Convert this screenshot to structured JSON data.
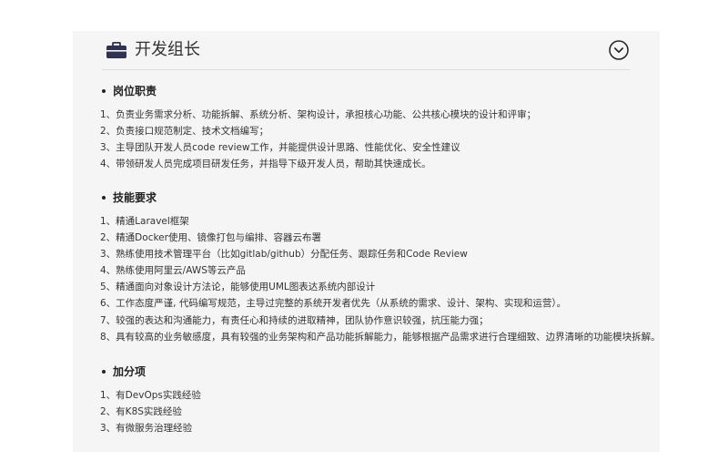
{
  "header": {
    "title": "开发组长",
    "icon": "briefcase-icon",
    "toggle_icon": "chevron-down-circle-icon"
  },
  "sections": [
    {
      "title": "岗位职责",
      "items": [
        "1、负责业务需求分析、功能拆解、系统分析、架构设计，承担核心功能、公共核心模块的设计和评审；",
        "2、负责接口规范制定、技术文档编写；",
        "3、主导团队开发人员code review工作，并能提供设计思路、性能优化、安全性建议",
        "4、带领研发人员完成项目研发任务，并指导下级开发人员，帮助其快速成长。"
      ]
    },
    {
      "title": "技能要求",
      "items": [
        "1、精通Laravel框架",
        "2、精通Docker使用、镜像打包与编排、容器云布署",
        "3、熟练使用技术管理平台（比如gitlab/github）分配任务、跟踪任务和Code Review",
        "4、熟练使用阿里云/AWS等云产品",
        "5、精通面向对象设计方法论，能够使用UML图表达系统内部设计",
        "6、工作态度严谨, 代码编写规范，主导过完整的系统开发者优先（从系统的需求、设计、架构、实现和运营）。",
        "7、较强的表达和沟通能力，有责任心和持续的进取精神，团队协作意识较强，抗压能力强；",
        "8、具有较高的业务敏感度，具有较强的业务架构和产品功能拆解能力，能够根据产品需求进行合理细致、边界清晰的功能模块拆解。"
      ]
    },
    {
      "title": "加分项",
      "items": [
        "1、有DevOps实践经验",
        "2、有K8S实践经验",
        "3、有微服务治理经验"
      ]
    }
  ]
}
